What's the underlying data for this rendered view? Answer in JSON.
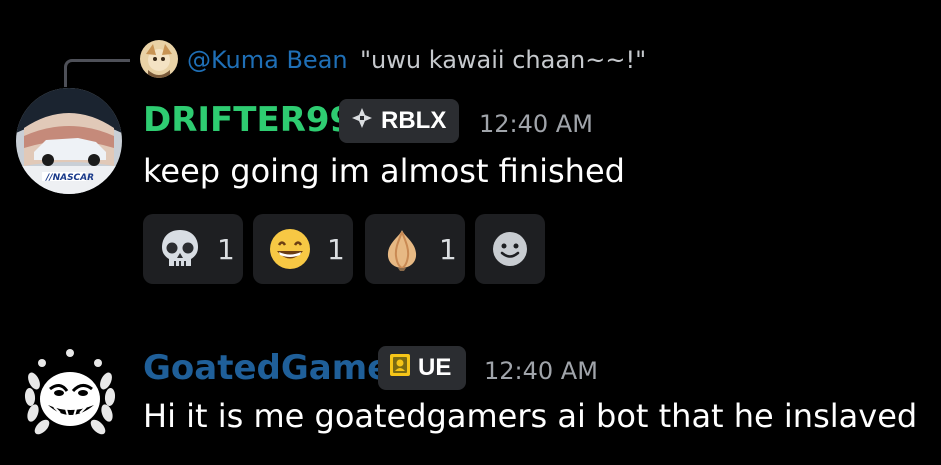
{
  "reply": {
    "author": "@Kuma Bean",
    "text": "\"uwu kawaii chaan~~!\""
  },
  "messages": [
    {
      "username": "DRIFTER99",
      "username_color": "#2ecc71",
      "tag": "RBLX",
      "tag_icon": "diamond-sparkle-icon",
      "time": "12:40 AM",
      "content": "keep going im almost finished",
      "avatar_icon": "race-helmet-avatar",
      "reactions": [
        {
          "emoji": "skull-emoji",
          "count": "1"
        },
        {
          "emoji": "grinning-face-emoji",
          "count": "1"
        },
        {
          "emoji": "onion-emoji",
          "count": "1"
        },
        {
          "emoji": "add-reaction-icon",
          "count": ""
        }
      ]
    },
    {
      "username": "GoatedGamer",
      "username_color": "#1f5f99",
      "tag": "UE",
      "tag_icon": "ue-badge-icon",
      "time": "12:40 AM",
      "content": "Hi it is me goatedgamers ai bot that he inslaved",
      "avatar_icon": "trollface-laurel-avatar"
    }
  ]
}
